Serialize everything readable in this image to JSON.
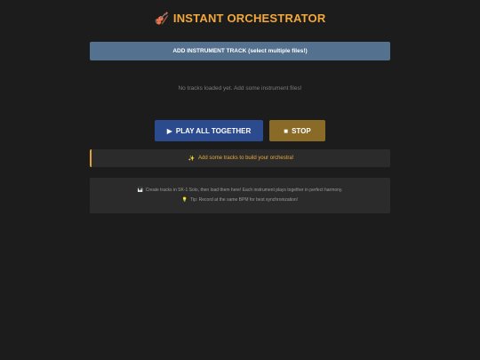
{
  "header": {
    "icon": "violin-icon",
    "icon_glyph": "🎻",
    "title": "INSTANT ORCHESTRATOR"
  },
  "add_track": {
    "label": "ADD INSTRUMENT TRACK (select multiple files!)"
  },
  "tracks": {
    "empty_message": "No tracks loaded yet. Add some instrument files!"
  },
  "controls": {
    "play_icon": "▶",
    "play_label": "PLAY ALL TOGETHER",
    "stop_icon": "■",
    "stop_label": "STOP"
  },
  "status": {
    "icon_glyph": "✨",
    "message": "Add some tracks to build your orchestra!"
  },
  "info": {
    "line1_icon": "🎹",
    "line1": "Create tracks in SK-1 Solo, then load them here! Each instrument plays together in perfect harmony.",
    "line2_icon": "💡",
    "line2": "Tip: Record at the same BPM for best synchronization!"
  },
  "colors": {
    "background": "#1c1c1c",
    "title": "#f2a83a",
    "add_button": "#54718f",
    "play_button": "#2c4a8e",
    "stop_button": "#8a6a27",
    "status_accent": "#e0a23a",
    "panel": "#2b2b2b"
  }
}
